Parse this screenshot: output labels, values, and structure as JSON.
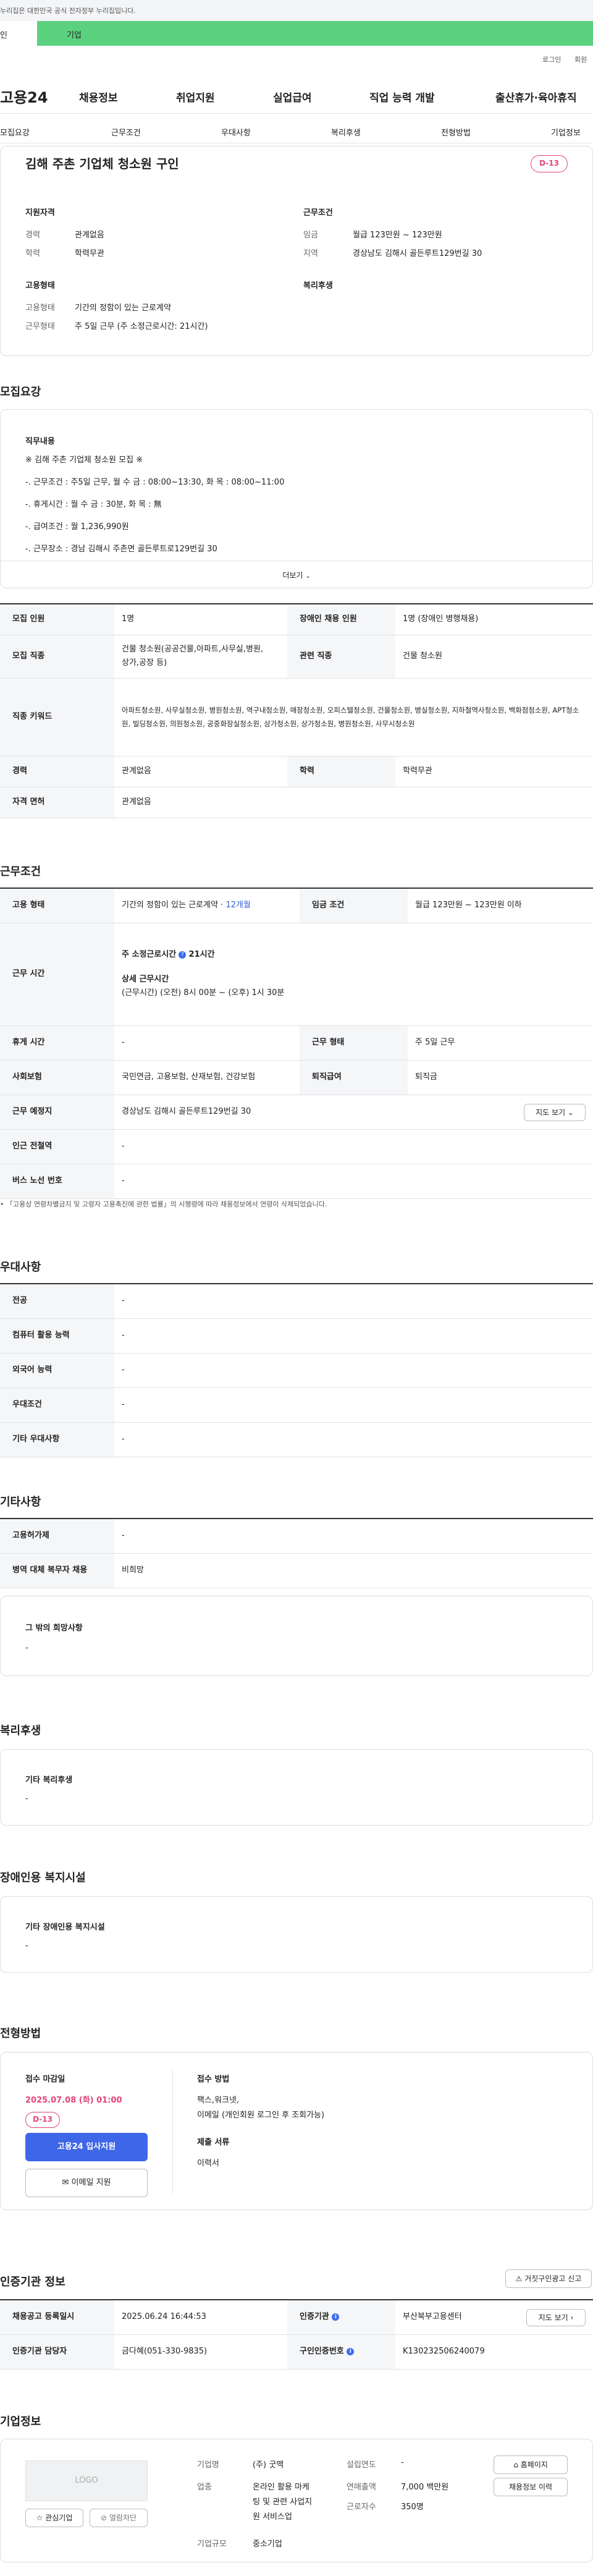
{
  "top": {
    "notice": "누리집은 대한민국 공식 전자정부 누리집입니다.",
    "tab_personal": "인",
    "tab_company": "기업"
  },
  "util": {
    "login": "로그인",
    "join": "회원"
  },
  "gnb": {
    "logo": "고용24",
    "menus": [
      "채용정보",
      "취업지원",
      "실업급여",
      "직업 능력 개발",
      "출산휴가·육아휴직"
    ]
  },
  "lnb": [
    "모집요강",
    "근무조건",
    "우대사항",
    "복리후생",
    "전형방법",
    "기업정보"
  ],
  "summary": {
    "title": "김해 주촌 기업체 청소원 구인",
    "dday": "D-13",
    "qual_h": "지원자격",
    "career_l": "경력",
    "career_v": "관계없음",
    "edu_l": "학력",
    "edu_v": "학력무관",
    "cond_h": "근무조건",
    "wage_l": "임금",
    "wage_v": "월급 123만원 ~ 123만원",
    "area_l": "지역",
    "area_v": "경상남도 김해시 골든루트129번길 30",
    "emp_h": "고용형태",
    "emptype_l": "고용형태",
    "emptype_v": "기간의 정함이 있는 근로계약",
    "worktype_l": "근무형태",
    "worktype_v": "주 5일 근무 (주 소정근로시간: 21시간)",
    "welfare_h": "복리후생"
  },
  "recruit": {
    "heading": "모집요강",
    "job_h": "직무내용",
    "lines": [
      "※ 김해 주촌 기업체 청소원 모집 ※",
      "-. 근무조건 : 주5일 근무, 월 수 금 : 08:00~13:30, 화 목 : 08:00~11:00",
      "-. 휴게시간 : 월 수 금 : 30분, 화 목 : 無",
      "-. 급여조건 : 월 1,236,990원",
      "-. 근무장소 : 경남 김해시 주촌면 골든루트로129번길 30"
    ],
    "more": "더보기",
    "rows": [
      {
        "th": "모집 인원",
        "td": "1명",
        "th2": "장애인 채용 인원",
        "td2": "1명 (장애인 병행채용)"
      },
      {
        "th": "모집 직종",
        "td": "건물 청소원(공공건물,아파트,사무실,병원,\n상가,공장 등)",
        "th2": "관련 직종",
        "td2": "건물 청소원"
      },
      {
        "th": "직종 키워드",
        "td": "아파트청소원, 사무실청소원, 병원청소원, 역구내청소원, 매장청소원, 오피스텔청소원, 건물청소원, 병실청소원, 지하철역사청소원, 백화점청소원, APT청소원, 빌딩청소원, 의원청소원, 공중화장실청소원, 상가청소원, 상가청소원, 병원청소원, 사무시청소원"
      },
      {
        "th": "경력",
        "td": "관계없음",
        "th2": "학력",
        "td2": "학력무관"
      },
      {
        "th": "자격 면허",
        "td": "관계없음"
      }
    ]
  },
  "workcond": {
    "heading": "근무조건",
    "emp_th": "고용 형태",
    "emp_td": "기간의 정함이 있는 근로계약 · ",
    "emp_period": "12개월",
    "wage_th": "임금 조건",
    "wage_td": "월급 123만원 ~ 123만원 이하",
    "time_th": "근무 시간",
    "time_1": "주 소정근로시간",
    "time_1v": "21시간",
    "time_2": "상세 근무시간",
    "time_3": "(근무시간) (오전) 8시 00분 ~ (오후) 1시 30분",
    "rest_th": "휴게 시간",
    "rest_td": "-",
    "type_th": "근무 형태",
    "type_td": "주 5일 근무",
    "ins_th": "사회보험",
    "ins_td": "국민연금, 고용보험, 산재보험, 건강보험",
    "sev_th": "퇴직급여",
    "sev_td": "퇴직금",
    "place_th": "근무 예정지",
    "place_td": "경상남도 김해시 골든루트129번길 30",
    "map_btn": "지도 보기",
    "sub_th": "인근 전철역",
    "sub_td": "-",
    "bus_th": "버스 노선 번호",
    "bus_td": "-",
    "note": "「고용상 연령차별금지 및 고령자 고용촉진에 관한 법률」의 시행령에 따라 채용정보에서 연령이 삭제되었습니다."
  },
  "pref": {
    "heading": "우대사항",
    "rows": [
      {
        "th": "전공",
        "td": "-"
      },
      {
        "th": "컴퓨터 활용 능력",
        "td": "-"
      },
      {
        "th": "외국어 능력",
        "td": "-"
      },
      {
        "th": "우대조건",
        "td": "-"
      },
      {
        "th": "기타 우대사항",
        "td": "-"
      }
    ]
  },
  "etc": {
    "heading": "기타사항",
    "rows": [
      {
        "th": "고용허가제",
        "td": "-"
      },
      {
        "th": "병역 대체 복무자 채용",
        "td": "비희망"
      }
    ],
    "wish_h": "그 밖의 희망사항",
    "wish_v": "-"
  },
  "welfare": {
    "heading": "복리후생",
    "box_h": "기타 복리후생",
    "box_v": "-"
  },
  "disab": {
    "heading": "장애인용 복지시설",
    "box_h": "기타 장애인용 복지시설",
    "box_v": "-"
  },
  "process": {
    "heading": "전형방법",
    "deadline_h": "접수 마감일",
    "deadline_v": "2025.07.08 (화) 01:00",
    "dday": "D-13",
    "apply_btn": "고용24 입사지원",
    "email_btn": "이메일 지원",
    "method_h": "접수 방법",
    "method_v1": "팩스,워크넷,",
    "method_v2": "이메일 (개인회원 로그인 후 조회가능)",
    "docs_h": "제출 서류",
    "docs_v": "이력서"
  },
  "agency": {
    "heading": "인증기관 정보",
    "report_btn": "거짓구인광고 신고",
    "reg_th": "채용공고 등록일시",
    "reg_td": "2025.06.24 16:44:53",
    "org_th": "인증기관",
    "org_td": "부산북부고용센터",
    "map_btn": "지도 보기",
    "mgr_th": "인증기관 담당자",
    "mgr_td": "금다혜(051-330-9835)",
    "no_th": "구인인증번호",
    "no_td": "K130232506240079"
  },
  "company": {
    "heading": "기업정보",
    "logo": "LOGO",
    "fav_btn": "관심기업",
    "block_btn": "열람차단",
    "name_l": "기업명",
    "name_v": "(주) 굿맥",
    "year_l": "설립연도",
    "year_v": "-",
    "home_btn": "홈페이지",
    "biz_l": "업종",
    "biz_v": [
      "온라인 활용 마케",
      "팅 및 관련 사업지",
      "원 서비스업"
    ],
    "sales_l": "연매출액",
    "sales_v": "7,000 백만원",
    "emp_l": "근로자수",
    "emp_v": "350명",
    "jobs_btn": "채용정보 이력",
    "size_l": "기업규모",
    "size_v": "중소기업"
  }
}
